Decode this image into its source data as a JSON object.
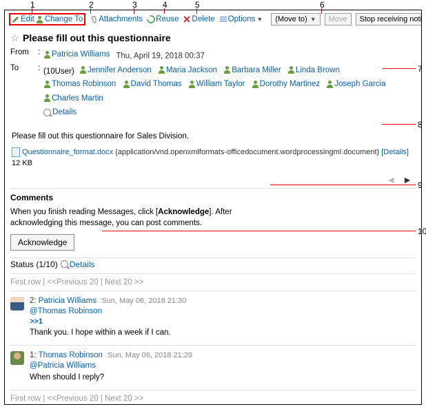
{
  "toolbar": {
    "edit": "Edit",
    "change_to": "Change To",
    "attachments": "Attachments",
    "reuse": "Reuse",
    "delete": "Delete",
    "options": "Options",
    "move_to": "(Move to)",
    "move": "Move",
    "stop_notif": "Stop receiving notifications"
  },
  "title": "Please fill out this questionnaire",
  "from_label": "From",
  "to_label": "To",
  "from_user": "Patricia Williams",
  "from_time": "Thu, April 19, 2018 00:37",
  "to_count": "(10User)",
  "to_users": [
    "Jennifer Anderson",
    "Maria Jackson",
    "Barbara Miller",
    "Linda Brown",
    "Thomas Robinson",
    "David Thomas",
    "William Taylor",
    "Dorothy Martinez",
    "Joseph Garcia",
    "Charles Martin"
  ],
  "details": "Details",
  "body_text": "Please fill out this questionnaire for Sales Division.",
  "attachment": {
    "name": "Questionnaire_format.docx",
    "type": "(application/vnd.openxmlformats-officedocument.wordprocessingml.document)",
    "details": "[Details]",
    "size": "12 KB"
  },
  "comments_h": "Comments",
  "ack_text_a": "When you finish reading Messages, click [",
  "ack_text_b": "Acknowledge",
  "ack_text_c": "]. After acknowledging this message, you can post comments.",
  "ack_btn": "Acknowledge",
  "status_a": "Status (1/10)",
  "pager": {
    "first": "First row",
    "prev": "<<Previous 20",
    "next": "Next 20 >>",
    "sep": "  |  "
  },
  "comments": [
    {
      "n": "2:",
      "user": "Patricia Williams",
      "time": "Sun, May 06, 2018 21:30",
      "mention": "@Thomas Robinson",
      "ref": ">>1",
      "body": "Thank you. I hope within a week if I can."
    },
    {
      "n": "1:",
      "user": "Thomas Robinson",
      "time": "Sun, May 06, 2018 21:29",
      "mention": "@Patricia Williams",
      "ref": "",
      "body": "When should I reply?"
    }
  ],
  "ann": {
    "1": "1",
    "2": "2",
    "3": "3",
    "4": "4",
    "5": "5",
    "6": "6",
    "7": "7",
    "8": "8",
    "9": "9",
    "10": "10"
  }
}
